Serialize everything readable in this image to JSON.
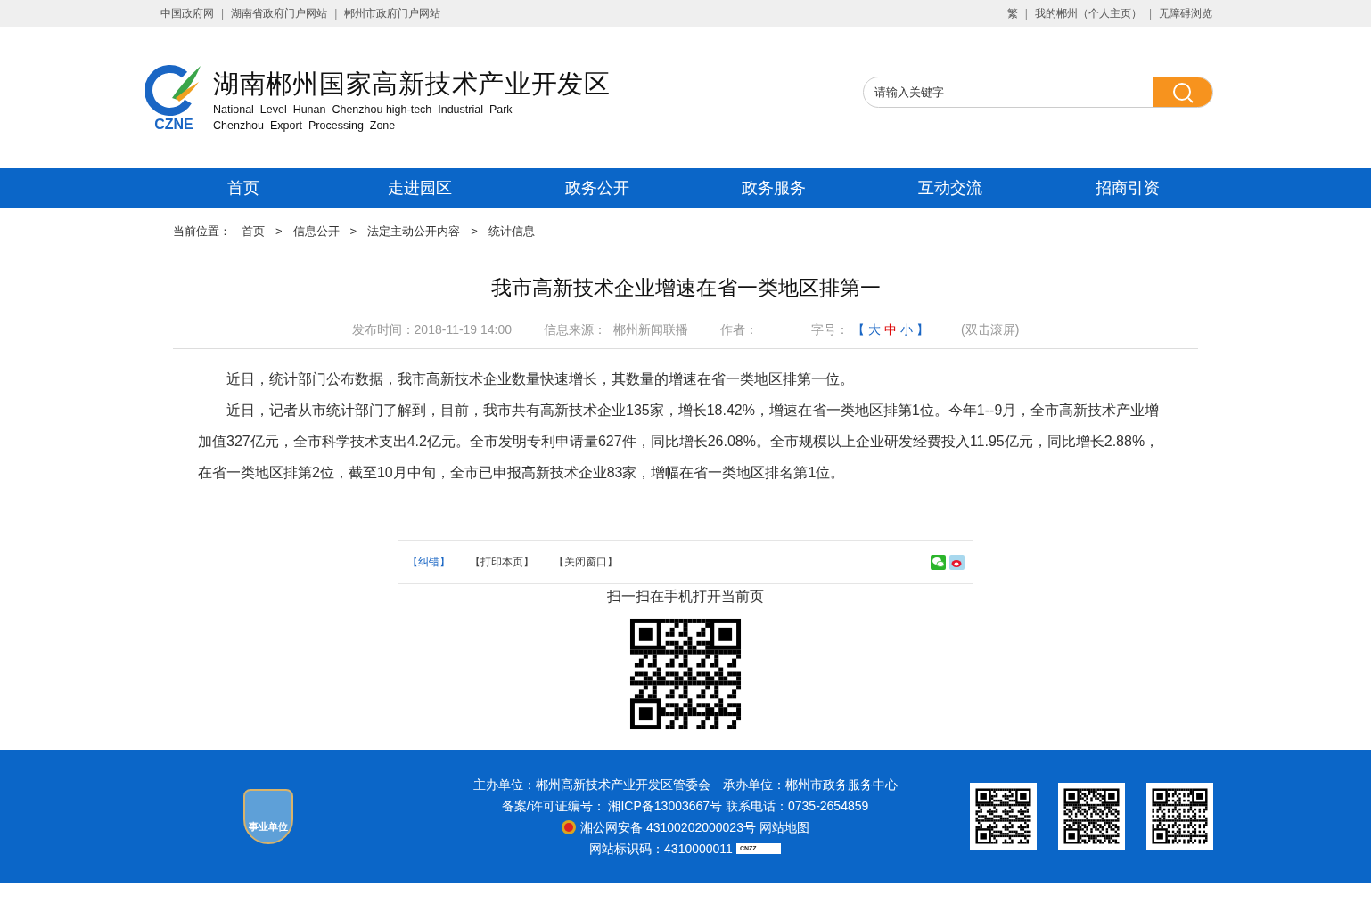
{
  "top_bar": {
    "separator": "|",
    "left_links": [
      "中国政府网",
      "湖南省政府门户网站",
      "郴州市政府门户网站"
    ],
    "right_links": [
      "繁",
      "我的郴州（个人主页）",
      "无障碍浏览"
    ]
  },
  "header": {
    "logo_text": "CZNE",
    "title": "湖南郴州国家高新技术产业开发区",
    "subtitle_lines": [
      "National  Level  Hunan  Chenzhou high-tech  Industrial  Park",
      "Chenzhou  Export  Processing  Zone"
    ],
    "search": {
      "placeholder": "请输入关键字"
    }
  },
  "nav": [
    {
      "label": "首页",
      "selected": false
    },
    {
      "label": "走进园区",
      "selected": false
    },
    {
      "label": "政务公开",
      "selected": false
    },
    {
      "label": "政务服务",
      "selected": false
    },
    {
      "label": "互动交流",
      "selected": false
    },
    {
      "label": "招商引资",
      "selected": false
    }
  ],
  "breadcrumb": {
    "label": "当前位置：",
    "items": [
      "首页",
      "信息公开",
      "法定主动公开内容",
      "统计信息"
    ],
    "separator": ">"
  },
  "article": {
    "title": "我市高新技术企业增速在省一类地区排第一",
    "meta": {
      "published": "发布时间：2018-11-19 14:00",
      "source_label": "信息来源：",
      "source": "郴州新闻联播",
      "author_label": "作者：",
      "font_label": "字号：",
      "bracket_open": "【",
      "bracket_close": "】",
      "font_sizes": [
        {
          "label": "大",
          "selected": false
        },
        {
          "label": "中",
          "selected": true
        },
        {
          "label": "小",
          "selected": false
        }
      ],
      "scroll": "(双击滚屏)"
    },
    "paragraphs": [
      "近日，统计部门公布数据，我市高新技术企业数量快速增长，其数量的增速在省一类地区排第一位。",
      "近日，记者从市统计部门了解到，目前，我市共有高新技术企业135家，增长18.42%，增速在省一类地区排第1位。今年1--9月，全市高新技术产业增加值327亿元，全市科学技术支出4.2亿元。全市发明专利申请量627件，同比增长26.08%。全市规模以上企业研发经费投入11.95亿元，同比增长2.88%，在省一类地区排第2位，截至10月中旬，全市已申报高新技术企业83家，增幅在省一类地区排名第1位。"
    ]
  },
  "actions": [
    {
      "label": "【纠错】",
      "kind": "link"
    },
    {
      "label": "【打印本页】",
      "kind": "plain"
    },
    {
      "label": "【关闭窗口】",
      "kind": "plain"
    }
  ],
  "qr_caption": "扫一扫在手机打开当前页",
  "footer": {
    "badge_text": "事业单位",
    "lines": [
      "主办单位：郴州高新技术产业开发区管委会　承办单位：郴州市政务服务中心",
      "备案/许可证编号： 湘ICP备13003667号 联系电话：0735-2654859"
    ],
    "police": "湘公网安备 43100202000023号",
    "sitemap": "网站地图",
    "site_code": "网站标识码：4310000011",
    "stat_logo": "CNZZ"
  }
}
